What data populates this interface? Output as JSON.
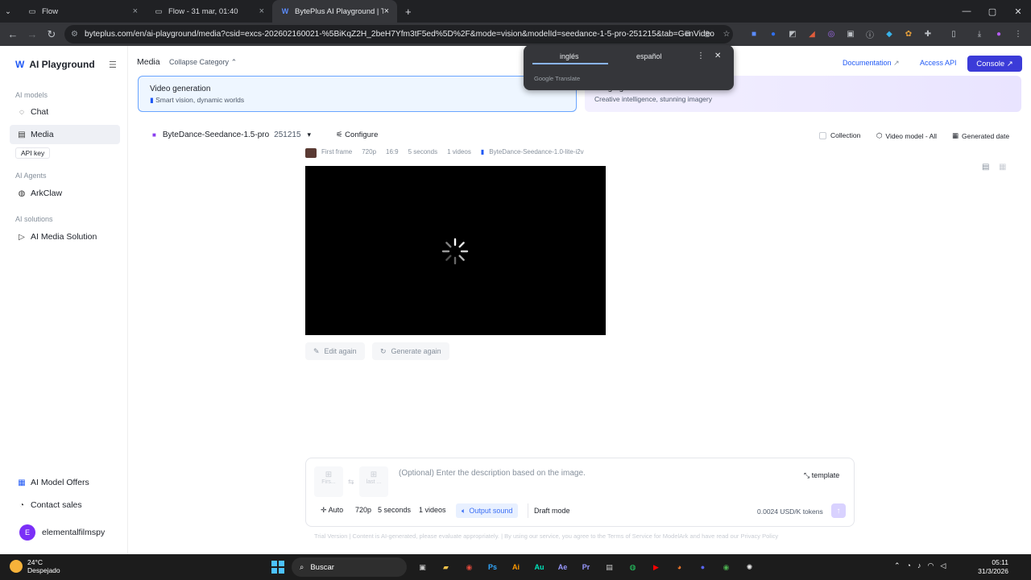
{
  "browser": {
    "tabs": [
      {
        "title": "Flow"
      },
      {
        "title": "Flow - 31 mar, 01:40"
      },
      {
        "title": "BytePlus AI Playground | Try Ai"
      }
    ],
    "url": "byteplus.com/en/ai-playground/media?csid=excs-202602160021-%5BiKqZ2H_2beH7Yfm3tF5ed%5D%2F&mode=vision&modelId=seedance-1-5-pro-251215&tab=GenVideo"
  },
  "translate_popup": {
    "lang_from": "inglés",
    "lang_to": "español",
    "brand": "Google Translate"
  },
  "sidebar": {
    "logo": "AI Playground",
    "section_models": "AI models",
    "item_chat": "Chat",
    "item_media": "Media",
    "api_key": "API key",
    "section_agents": "AI Agents",
    "item_arkclaw": "ArkClaw",
    "section_solutions": "AI solutions",
    "item_media_solution": "AI Media Solution",
    "item_offers": "AI Model Offers",
    "item_contact": "Contact sales",
    "user_initial": "E",
    "user_name": "elementalfilmspy"
  },
  "header": {
    "title": "Media",
    "collapse": "Collapse Category",
    "documentation": "Documentation",
    "access_api": "Access API",
    "console": "Console"
  },
  "cards": {
    "video_title": "Video generation",
    "video_sub": "Smart vision, dynamic worlds",
    "image_title": "Image generation",
    "image_sub": "Creative intelligence, stunning imagery"
  },
  "toolbar": {
    "model": "ByteDance-Seedance-1.5-pro",
    "version": "251215",
    "configure": "Configure",
    "collection": "Collection",
    "video_model": "Video model - All",
    "generated_date": "Generated date"
  },
  "result": {
    "frame": "First frame",
    "resolution": "720p",
    "ratio": "16:9",
    "duration": "5 seconds",
    "count": "1 videos",
    "model": "ByteDance-Seedance-1.0-lite-i2v",
    "edit_again": "Edit again",
    "generate_again": "Generate again"
  },
  "composer": {
    "first_label": "Firs...",
    "last_label": "last ...",
    "placeholder": "(Optional) Enter the description based on the image.",
    "template": "template",
    "ratio": "Auto",
    "resolution": "720p",
    "duration": "5 seconds",
    "count": "1 videos",
    "output_sound": "Output sound",
    "draft_mode": "Draft mode",
    "price": "0.0024 USD/K tokens"
  },
  "footer": "Trial Version | Content is AI-generated, please evaluate appropriately. | By using our service, you agree to the Terms of Service for ModelArk and have read our Privacy Policy",
  "taskbar": {
    "temp": "24°C",
    "weather": "Despejado",
    "search": "Buscar",
    "time": "05:11",
    "date": "31/3/2026"
  }
}
